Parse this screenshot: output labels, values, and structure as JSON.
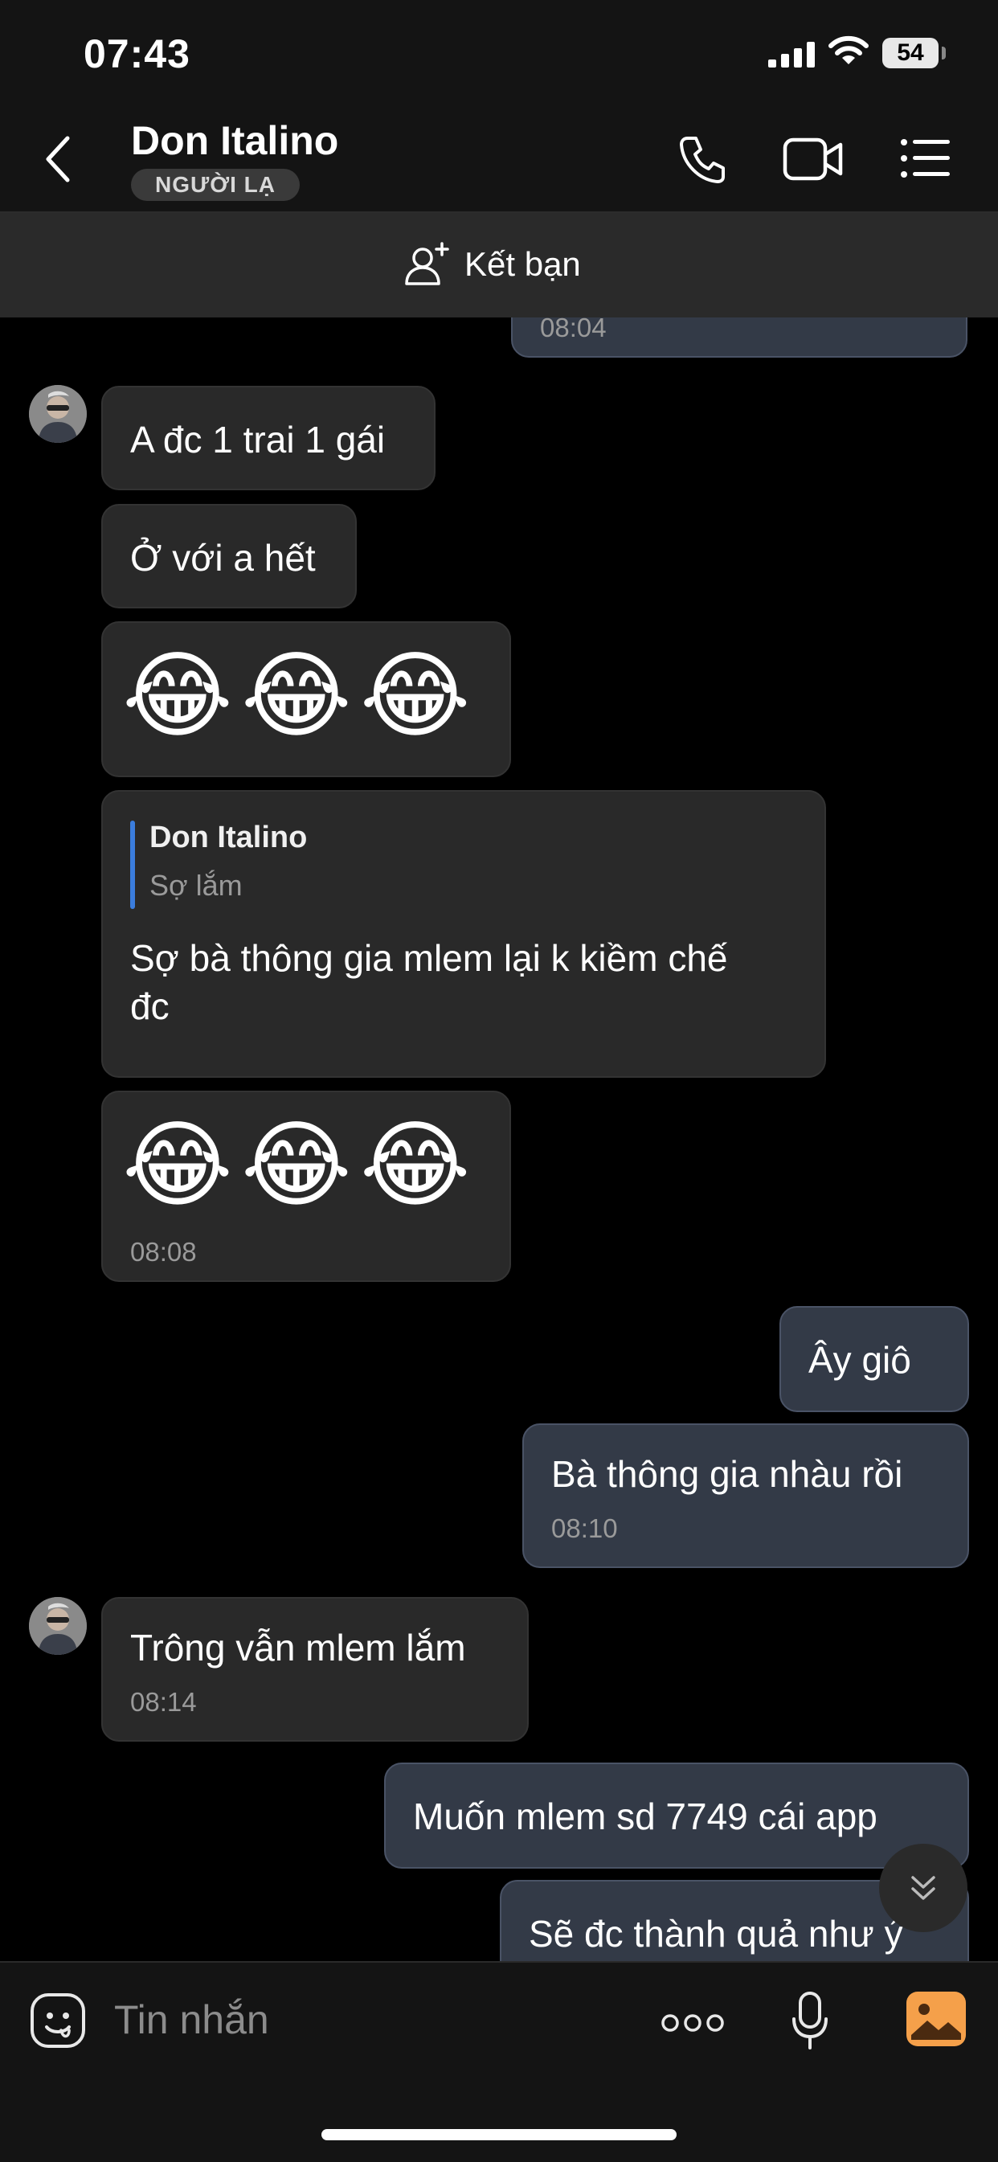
{
  "status_bar": {
    "time": "07:43",
    "battery": "54"
  },
  "header": {
    "contact_name": "Don Italino",
    "badge": "NGƯỜI LẠ",
    "icons": [
      "chevron-left-icon",
      "phone-icon",
      "video-camera-icon",
      "list-icon"
    ]
  },
  "friend_bar": {
    "label": "Kết bạn",
    "icon": "add-person-icon"
  },
  "messages": [
    {
      "direction": "out",
      "text": "",
      "time": "08:04"
    },
    {
      "direction": "in",
      "text": "A đc 1 trai 1 gái"
    },
    {
      "direction": "in",
      "text": "Ở với a hết"
    },
    {
      "direction": "in",
      "emoji": "😂😂😂"
    },
    {
      "direction": "in",
      "quote_name": "Don Italino",
      "quote_text": "Sợ lắm",
      "text_line1": "Sợ bà thông gia mlem lại k kiềm chế",
      "text_line2": "đc"
    },
    {
      "direction": "in",
      "emoji": "😂😂😂",
      "time": "08:08"
    },
    {
      "direction": "out",
      "text": "Ây giô"
    },
    {
      "direction": "out",
      "text": "Bà thông gia nhàu rồi",
      "time": "08:10"
    },
    {
      "direction": "in",
      "text": "Trông vẫn mlem lắm",
      "time": "08:14"
    },
    {
      "direction": "out",
      "text": "Muốn mlem sd 7749 cái app"
    },
    {
      "direction": "out",
      "text": "Sẽ đc thành quả như ý"
    }
  ],
  "input_bar": {
    "placeholder": "Tin nhắn",
    "icons": [
      "sticker-icon",
      "more-icon",
      "microphone-icon",
      "image-icon"
    ]
  },
  "colors": {
    "background": "#000000",
    "bar": "#141414",
    "incoming_bubble": "#292929",
    "outgoing_bubble": "#333a47",
    "accent": "#3b7ddd",
    "image_icon": "#f5a04a"
  }
}
